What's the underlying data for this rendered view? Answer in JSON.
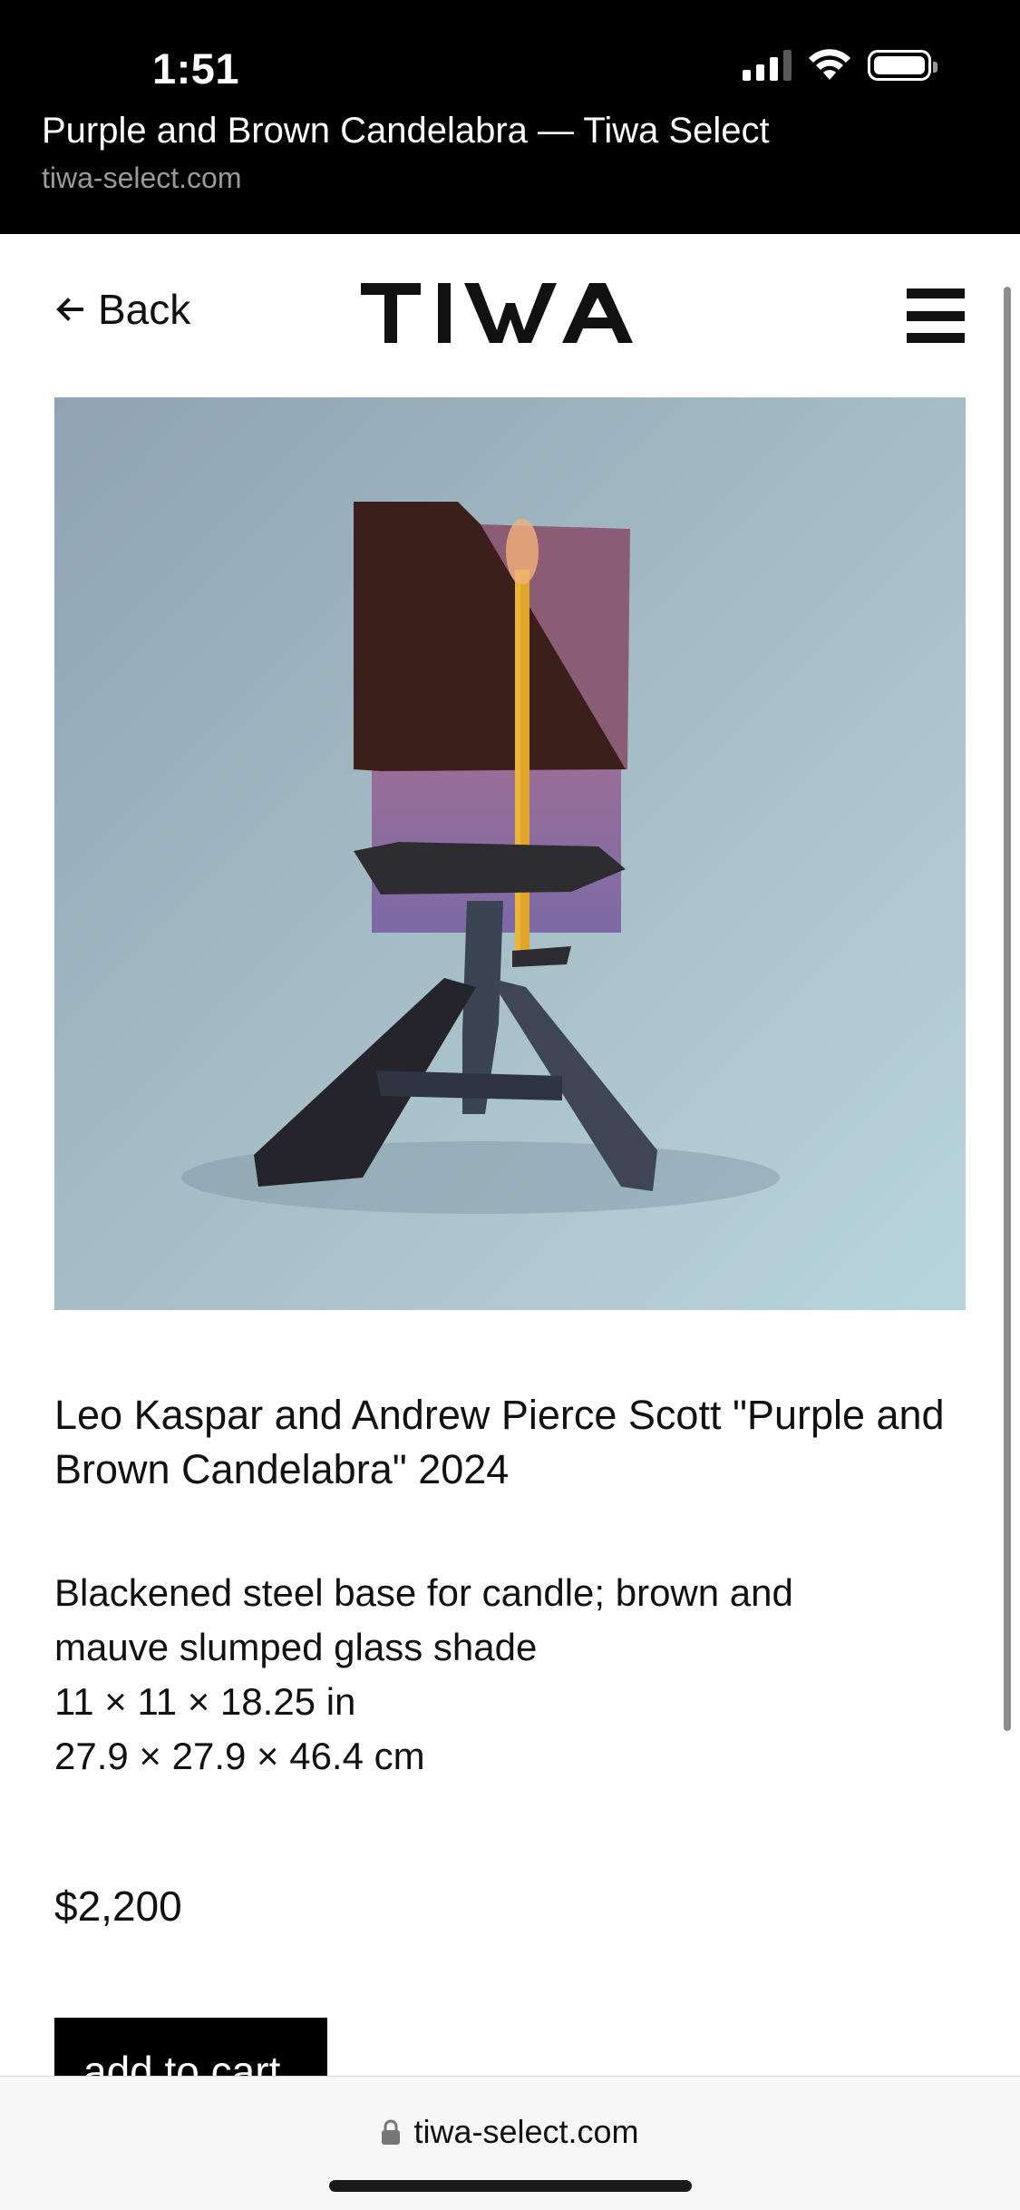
{
  "status_bar": {
    "time": "1:51",
    "icons": [
      "cellular-signal-icon",
      "wifi-icon",
      "battery-icon"
    ]
  },
  "browser": {
    "page_title": "Purple and Brown Candelabra — Tiwa Select",
    "domain": "tiwa-select.com",
    "url": "tiwa-select.com"
  },
  "header": {
    "back_label": "Back",
    "logo_text": "TIWA",
    "menu_icon": "hamburger-menu-icon"
  },
  "product": {
    "title": "Leo Kaspar and Andrew Pierce Scott \"Purple and Brown Candelabra\" 2024",
    "description_lines": [
      "Blackened steel base for candle; brown and",
      "mauve slumped glass shade",
      "11 × 11 × 18.25 in",
      "27.9 × 27.9 × 46.4 cm"
    ],
    "price": "$2,200",
    "add_to_cart_label": "add to cart"
  },
  "colors": {
    "background": "#ffffff",
    "text": "#111111",
    "button": "#000000",
    "chrome": "#000000"
  }
}
